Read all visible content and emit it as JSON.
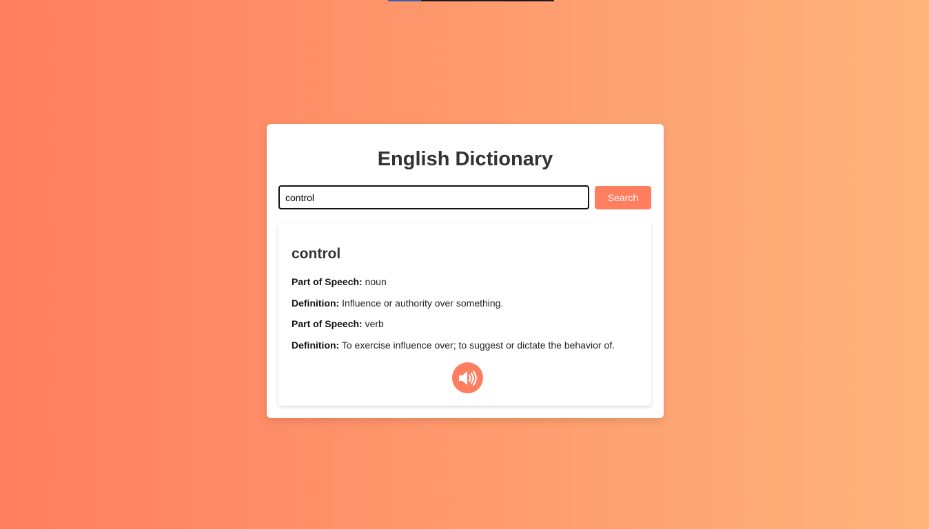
{
  "title": "English Dictionary",
  "search": {
    "value": "control",
    "button_label": "Search"
  },
  "result": {
    "word": "control",
    "entries": [
      {
        "label": "Part of Speech:",
        "value": "noun"
      },
      {
        "label": "Definition:",
        "value": "Influence or authority over something."
      },
      {
        "label": "Part of Speech:",
        "value": "verb"
      },
      {
        "label": "Definition:",
        "value": "To exercise influence over; to suggest or dictate the behavior of."
      }
    ],
    "audio_icon": "speaker-volume-icon"
  },
  "colors": {
    "gradient_start": "#ff7e5f",
    "gradient_end": "#feb47b",
    "accent": "#ff7e5f"
  }
}
